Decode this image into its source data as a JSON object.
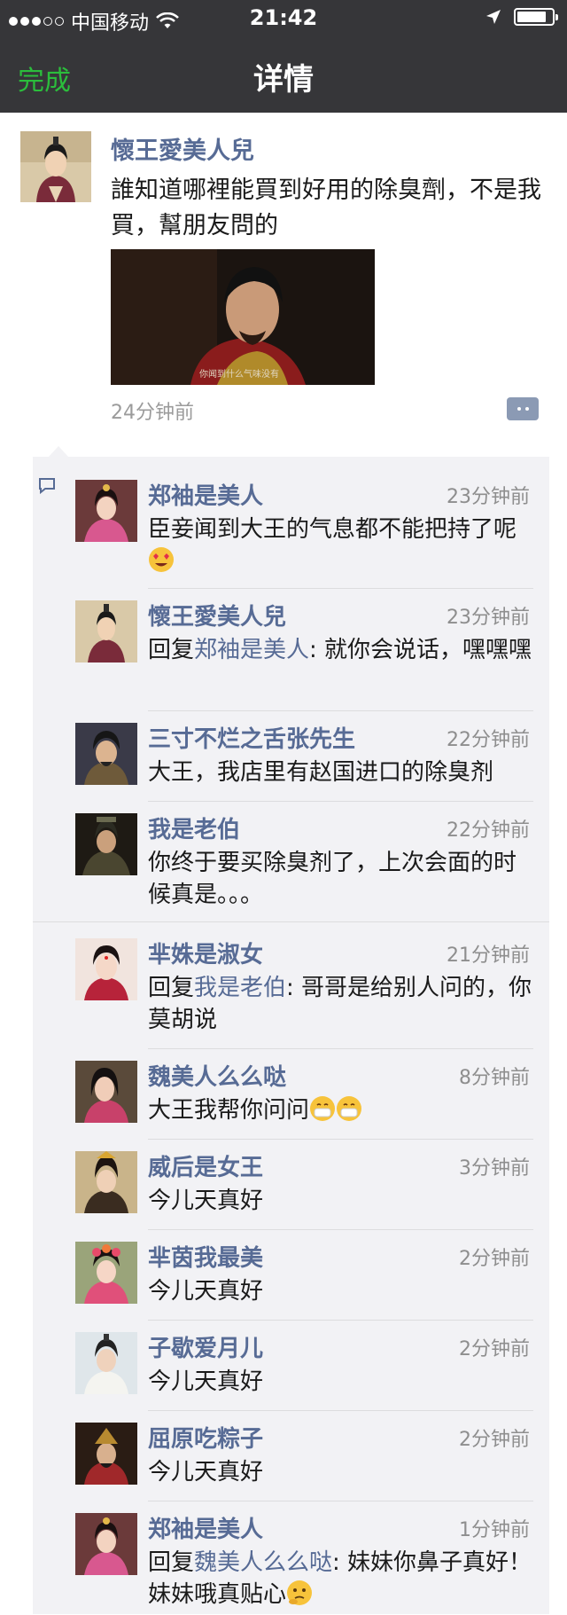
{
  "status_bar": {
    "carrier": "中国移动",
    "time": "21:42"
  },
  "nav": {
    "back_label": "完成",
    "title": "详情"
  },
  "post": {
    "author": "懷王愛美人兒",
    "text": "誰知道哪裡能買到好用的除臭劑，不是我買，幫朋友問的",
    "image_caption": "你闻到什么气味没有",
    "time": "24分钟前"
  },
  "colors": {
    "accent_green": "#2bbd3c",
    "name_blue": "#576b95",
    "topbar_bg": "#363639",
    "comment_bg": "#f2f2f5"
  },
  "comments": [
    {
      "name": "郑袖是美人",
      "time": "23分钟前",
      "text": "臣妾闻到大王的气息都不能把持了呢"
    },
    {
      "name": "懷王愛美人兒",
      "time": "23分钟前",
      "reply_prefix": "回复",
      "reply_to": "郑袖是美人",
      "text": ": 就你会说话，嘿嘿嘿"
    },
    {
      "name": "三寸不烂之舌张先生",
      "time": "22分钟前",
      "text": "大王，我店里有赵国进口的除臭剂"
    },
    {
      "name": "我是老伯",
      "time": "22分钟前",
      "text": "你终于要买除臭剂了，上次会面的时候真是。。。"
    },
    {
      "name": "芈姝是淑女",
      "time": "21分钟前",
      "reply_prefix": "回复",
      "reply_to": "我是老伯",
      "text": ": 哥哥是给别人问的，你莫胡说"
    },
    {
      "name": "魏美人么么哒",
      "time": "8分钟前",
      "text": "大王我帮你问问"
    },
    {
      "name": "威后是女王",
      "time": "3分钟前",
      "text": "今儿天真好"
    },
    {
      "name": "芈茵我最美",
      "time": "2分钟前",
      "text": "今儿天真好"
    },
    {
      "name": "子歇爱月儿",
      "time": "2分钟前",
      "text": "今儿天真好"
    },
    {
      "name": "屈原吃粽子",
      "time": "2分钟前",
      "text": "今儿天真好"
    },
    {
      "name": "郑袖是美人",
      "time": "1分钟前",
      "reply_prefix": "回复",
      "reply_to": "魏美人么么哒",
      "text": ": 妹妹你鼻子真好！妹妹哦真贴心"
    }
  ]
}
